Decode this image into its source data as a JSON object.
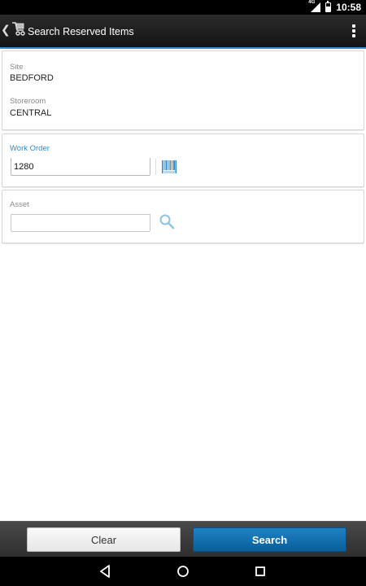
{
  "status_bar": {
    "network": "4G",
    "time": "10:58"
  },
  "action_bar": {
    "title": "Search Reserved Items",
    "icons": [
      "back-chevron-icon",
      "app-cart-icon",
      "overflow-menu-icon"
    ]
  },
  "form": {
    "site": {
      "label": "Site",
      "value": "BEDFORD"
    },
    "storeroom": {
      "label": "Storeroom",
      "value": "CENTRAL"
    },
    "work_order": {
      "label": "Work Order",
      "value": "1280",
      "icon": "barcode-icon"
    },
    "asset": {
      "label": "Asset",
      "value": "",
      "icon": "search-icon"
    }
  },
  "buttons": {
    "clear_label": "Clear",
    "search_label": "Search"
  },
  "colors": {
    "accent": "#2f8bcc",
    "search_button": "#0a6db0",
    "action_bar": "#1f1f1f"
  }
}
